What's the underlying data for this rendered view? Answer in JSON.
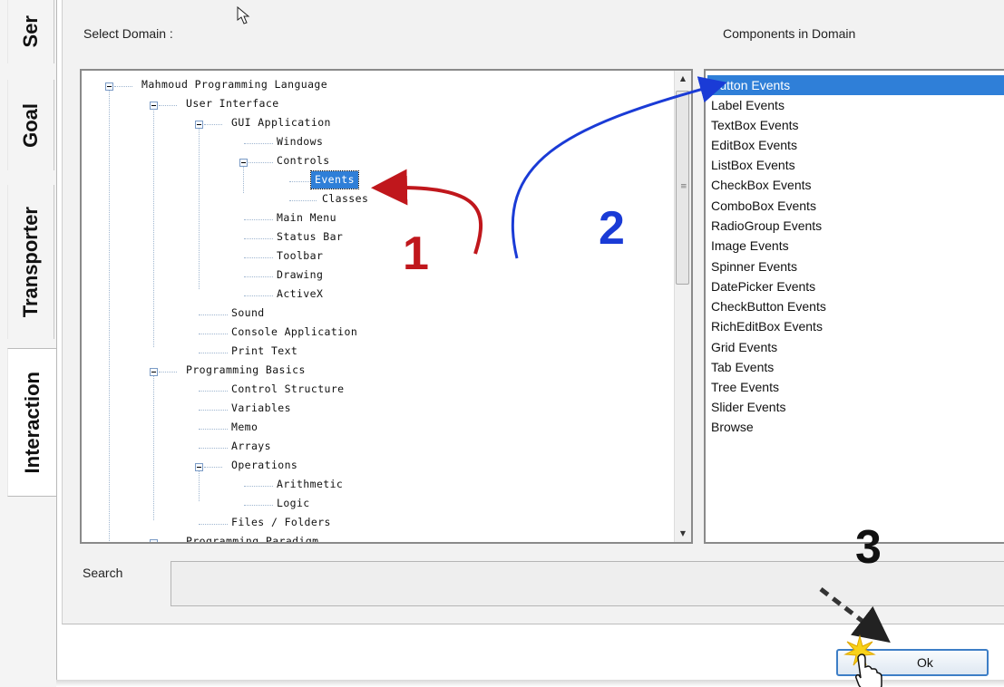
{
  "vertical_tabs": [
    {
      "label": "Ser",
      "active": false
    },
    {
      "label": "Goal",
      "active": false
    },
    {
      "label": "Transporter",
      "active": false
    },
    {
      "label": "Interaction",
      "active": true
    }
  ],
  "select_domain_label": "Select Domain :",
  "components_label": "Components in Domain",
  "tree": {
    "nodes": [
      {
        "label": "Mahmoud Programming Language",
        "expander": true
      },
      {
        "label": "User Interface",
        "expander": true
      },
      {
        "label": "GUI Application",
        "expander": true
      },
      {
        "label": "Windows",
        "expander": false
      },
      {
        "label": "Controls",
        "expander": true
      },
      {
        "label": "Events",
        "expander": false,
        "selected": true
      },
      {
        "label": "Classes",
        "expander": false
      },
      {
        "label": "Main Menu",
        "expander": false
      },
      {
        "label": "Status Bar",
        "expander": false
      },
      {
        "label": "Toolbar",
        "expander": false
      },
      {
        "label": "Drawing",
        "expander": false
      },
      {
        "label": "ActiveX",
        "expander": false
      },
      {
        "label": "Sound",
        "expander": false
      },
      {
        "label": "Console Application",
        "expander": false
      },
      {
        "label": "Print Text",
        "expander": false
      },
      {
        "label": "Programming Basics",
        "expander": true
      },
      {
        "label": "Control Structure",
        "expander": false
      },
      {
        "label": "Variables",
        "expander": false
      },
      {
        "label": "Memo",
        "expander": false
      },
      {
        "label": "Arrays",
        "expander": false
      },
      {
        "label": "Operations",
        "expander": true
      },
      {
        "label": "Arithmetic",
        "expander": false
      },
      {
        "label": "Logic",
        "expander": false
      },
      {
        "label": "Files / Folders",
        "expander": false
      },
      {
        "label": "Programming Paradigm",
        "expander": true
      }
    ]
  },
  "components": [
    "Button Events",
    "Label Events",
    "TextBox Events",
    "EditBox Events",
    "ListBox Events",
    "CheckBox Events",
    "ComboBox Events",
    "RadioGroup Events",
    "Image Events",
    "Spinner Events",
    "DatePicker Events",
    "CheckButton Events",
    "RichEditBox Events",
    "Grid Events",
    "Tab Events",
    "Tree Events",
    "Slider Events",
    "Browse"
  ],
  "selected_component": "Button Events",
  "search_label": "Search",
  "search_value": "",
  "ok_label": "Ok",
  "annotations": {
    "step1": "1",
    "step2": "2",
    "step3": "3",
    "step1_color": "#c0171c",
    "step2_color": "#1a3bd6",
    "step3_color": "#111111"
  },
  "colors": {
    "selection": "#2f7fd8",
    "ok_border": "#3d7ec6"
  }
}
